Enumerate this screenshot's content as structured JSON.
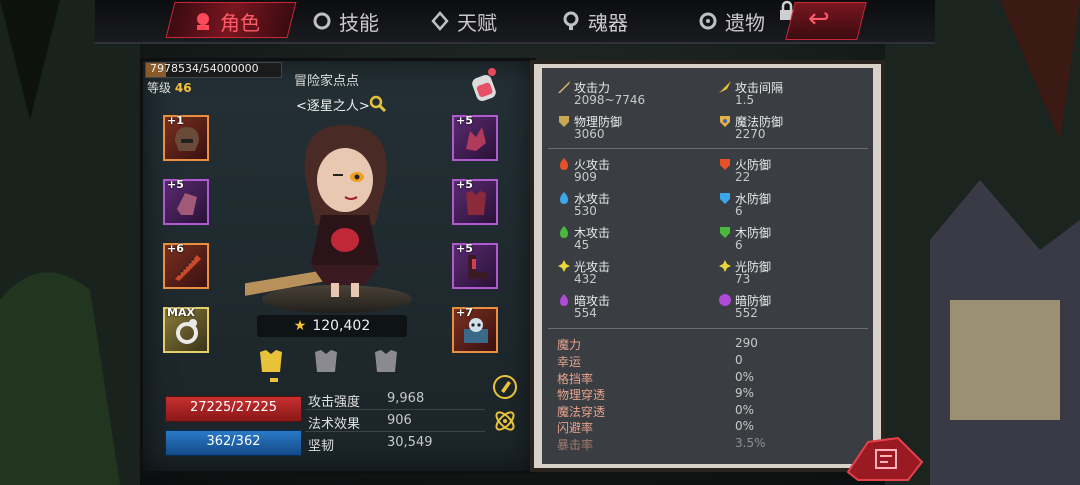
{
  "tabs": [
    {
      "label": "角色",
      "icon": "character-icon",
      "active": true
    },
    {
      "label": "技能",
      "icon": "skill-icon",
      "active": false
    },
    {
      "label": "天赋",
      "icon": "talent-icon",
      "active": false
    },
    {
      "label": "魂器",
      "icon": "soul-vessel-icon",
      "active": false
    },
    {
      "label": "遗物",
      "icon": "relic-icon",
      "active": false
    }
  ],
  "player": {
    "exp_text": "7978534/54000000",
    "exp_fraction": 0.148,
    "level_label": "等级",
    "level": "46",
    "name": "冒险家点点",
    "title": "<逐星之人>",
    "power": "120,402",
    "hp": "27225/27225",
    "mp": "362/362"
  },
  "equipment": {
    "left": [
      {
        "plus": "+1",
        "icon": "helmet-icon",
        "rarity": "orange"
      },
      {
        "plus": "+5",
        "icon": "gauntlet-icon",
        "rarity": "purple"
      },
      {
        "plus": "+6",
        "icon": "chainsaw-sword-icon",
        "rarity": "orange"
      },
      {
        "plus": "MAX",
        "icon": "ring-icon",
        "rarity": "gold"
      }
    ],
    "right": [
      {
        "plus": "+5",
        "icon": "claw-icon",
        "rarity": "purple"
      },
      {
        "plus": "+5",
        "icon": "armor-icon",
        "rarity": "purple"
      },
      {
        "plus": "+5",
        "icon": "boots-icon",
        "rarity": "purple"
      },
      {
        "plus": "+7",
        "icon": "skull-chest-icon",
        "rarity": "orange"
      }
    ]
  },
  "core_stats": [
    {
      "label": "攻击强度",
      "value": "9,968"
    },
    {
      "label": "法术效果",
      "value": "906"
    },
    {
      "label": "坚韧",
      "value": "30,549"
    }
  ],
  "stats_top": [
    {
      "label": "攻击力",
      "value": "2098~7746",
      "icon": "sword-icon",
      "color": "#d8c070"
    },
    {
      "label": "攻击间隔",
      "value": "1.5",
      "icon": "speed-icon",
      "color": "#e8c33a"
    },
    {
      "label": "物理防御",
      "value": "3060",
      "icon": "shield-icon",
      "color": "#c8a850"
    },
    {
      "label": "魔法防御",
      "value": "2270",
      "icon": "magic-shield-icon",
      "color": "#e8b040"
    }
  ],
  "element_stats": [
    {
      "atk_label": "火攻击",
      "atk": "909",
      "def_label": "火防御",
      "def": "22",
      "color": "#e8502a"
    },
    {
      "atk_label": "水攻击",
      "atk": "530",
      "def_label": "水防御",
      "def": "6",
      "color": "#3aa8e8"
    },
    {
      "atk_label": "木攻击",
      "atk": "45",
      "def_label": "木防御",
      "def": "6",
      "color": "#4ab83a"
    },
    {
      "atk_label": "光攻击",
      "atk": "432",
      "def_label": "光防御",
      "def": "73",
      "color": "#e8d83a"
    },
    {
      "atk_label": "暗攻击",
      "atk": "554",
      "def_label": "暗防御",
      "def": "552",
      "color": "#b04ad8"
    }
  ],
  "misc_stats": [
    {
      "label": "魔力",
      "value": "290"
    },
    {
      "label": "幸运",
      "value": "0"
    },
    {
      "label": "格挡率",
      "value": "0%"
    },
    {
      "label": "物理穿透",
      "value": "9%"
    },
    {
      "label": "魔法穿透",
      "value": "0%"
    },
    {
      "label": "闪避率",
      "value": "0%"
    },
    {
      "label": "暴击率",
      "value": "3.5%"
    }
  ]
}
